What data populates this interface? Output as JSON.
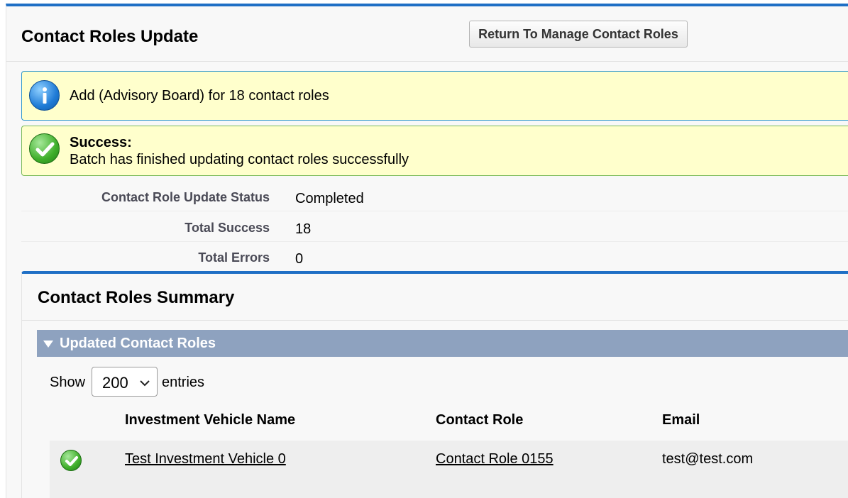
{
  "header": {
    "title": "Contact Roles Update",
    "return_button": "Return To Manage Contact Roles"
  },
  "messages": {
    "info": {
      "text": "Add (Advisory Board) for 18 contact roles",
      "icon": "info-icon"
    },
    "success": {
      "title": "Success:",
      "text": "Batch has finished updating contact roles successfully",
      "icon": "success-check-icon"
    }
  },
  "details": [
    {
      "label": "Contact Role Update Status",
      "value": "Completed"
    },
    {
      "label": "Total Success",
      "value": "18"
    },
    {
      "label": "Total Errors",
      "value": "0"
    }
  ],
  "summary": {
    "title": "Contact Roles Summary",
    "section_title": "Updated Contact Roles",
    "show_label": "Show",
    "entries_value": "200",
    "entries_label": "entries",
    "columns": [
      "Investment Vehicle Name",
      "Contact Role",
      "Email"
    ],
    "rows": [
      {
        "status_icon": "success-check-icon",
        "vehicle": "Test Investment Vehicle 0",
        "contact_role": "Contact Role 0155",
        "email": "test@test.com"
      }
    ]
  },
  "colors": {
    "accent_blue": "#1f6fc5",
    "message_bg": "#ffffcc",
    "section_bar": "#8ea2bf",
    "success_green": "#3fae2a"
  }
}
